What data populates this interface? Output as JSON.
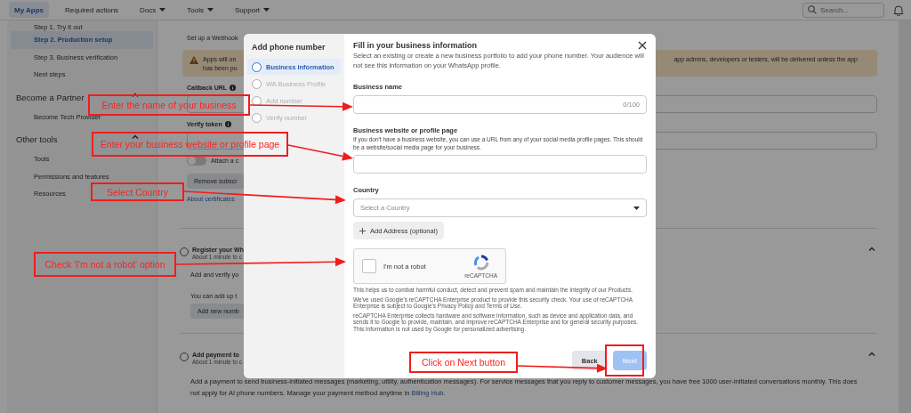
{
  "topbar": {
    "tabs": [
      {
        "label": "My Apps",
        "selected": true,
        "has_menu": false
      },
      {
        "label": "Required actions",
        "selected": false,
        "has_menu": false
      },
      {
        "label": "Docs",
        "selected": false,
        "has_menu": true
      },
      {
        "label": "Tools",
        "selected": false,
        "has_menu": true
      },
      {
        "label": "Support",
        "selected": false,
        "has_menu": true
      }
    ],
    "search": {
      "placeholder": "Search..."
    }
  },
  "sidebar": {
    "steps": [
      {
        "label": "Step 1. Try it out",
        "selected": false
      },
      {
        "label": "Step 2. Production setup",
        "selected": true
      },
      {
        "label": "Step 3. Business verification",
        "selected": false
      },
      {
        "label": "Next steps",
        "selected": false
      }
    ],
    "sections": [
      {
        "title": "Become a Partner",
        "expanded": true,
        "items": [
          {
            "label": "Become Tech Provider"
          }
        ]
      },
      {
        "title": "Other tools",
        "expanded": true,
        "items": [
          {
            "label": "Tools"
          },
          {
            "label": "Permissions and features"
          },
          {
            "label": "Resources"
          }
        ]
      }
    ]
  },
  "main": {
    "heading": "Set up a Webhook",
    "warning": {
      "lines": [
        "Apps will on",
        "has been pu"
      ],
      "trailing": "app admins, developers or testers, will be delivered unless the app"
    },
    "fields": [
      {
        "label": "Callback URL"
      },
      {
        "label": "Verify token"
      }
    ],
    "toggle": {
      "label": "Attach a c",
      "on": false
    },
    "remove_button": "Remove subscr",
    "certificates_link": "About certificates",
    "sections": [
      {
        "title": "Register your Wh",
        "subtitle": "About 1 minute to c",
        "checked": false,
        "expanded": true,
        "body": [
          {
            "kind": "text",
            "text": "Add and verify yo"
          },
          {
            "kind": "text",
            "text": "You can add up t"
          },
          {
            "kind": "button",
            "text": "Add new numb"
          }
        ]
      },
      {
        "title": "Add payment to",
        "subtitle": "About 1 minute to c",
        "checked": false,
        "expanded": true,
        "body": [
          {
            "kind": "paragraph",
            "text": "Add a payment to send business-initiated messages (marketing, utility, authentication messages). For service messages that you reply to customer messages, you have free 1000 user-initiated conversations monthly. This does not apply for AI phone numbers. Manage your payment method anytime in",
            "link": "Billing Hub",
            "after": "."
          }
        ]
      }
    ]
  },
  "modal": {
    "title": "Add phone number",
    "steps": [
      {
        "label": "Business information",
        "selected": true,
        "disabled": false
      },
      {
        "label": "WA Business Profile",
        "selected": false,
        "disabled": true
      },
      {
        "label": "Add number",
        "selected": false,
        "disabled": true
      },
      {
        "label": "Verify number",
        "selected": false,
        "disabled": true
      }
    ],
    "form": {
      "title": "Fill in your business information",
      "description": "Select an existing or create a new business portfolio to add your phone number. Your audience will not see this information on your WhatsApp profile.",
      "fields": [
        {
          "kind": "text",
          "label": "Business name",
          "counter": "0/100"
        },
        {
          "kind": "text",
          "label": "Business website or profile page",
          "help": "If you don't have a business website, you can use a URL from any of your social media profile pages. This should be a website/social media page for your business."
        },
        {
          "kind": "select",
          "label": "Country",
          "placeholder": "Select a Country"
        }
      ],
      "add_address": "Add Address (optional)",
      "captcha": {
        "label": "I'm not a robot",
        "brand": "reCAPTCHA",
        "checked": false
      },
      "notes": [
        "This helps us to combat harmful conduct, detect and prevent spam and maintain the integrity of our Products.",
        "We've used Google's reCAPTCHA Enterprise product to provide this security check. Your use of reCAPTCHA Enterprise is subject to Google's Privacy Policy and Terms of Use.",
        "reCAPTCHA Enterprise collects hardware and software information, such as device and application data, and sends it to Google to provide, maintain, and improve reCAPTCHA Enterprise and for general security purposes. This information is not used by Google for personalized advertising."
      ],
      "buttons": [
        {
          "label": "Back",
          "kind": "secondary",
          "disabled": false
        },
        {
          "label": "Next",
          "kind": "primary",
          "disabled": true
        }
      ]
    }
  },
  "annotations": [
    {
      "text": "Enter the name of your business"
    },
    {
      "text": "Enter your business website or profile page"
    },
    {
      "text": "Select Country"
    },
    {
      "text": "Check 'I'm not a robot' option"
    },
    {
      "text": "Click on Next button"
    }
  ]
}
